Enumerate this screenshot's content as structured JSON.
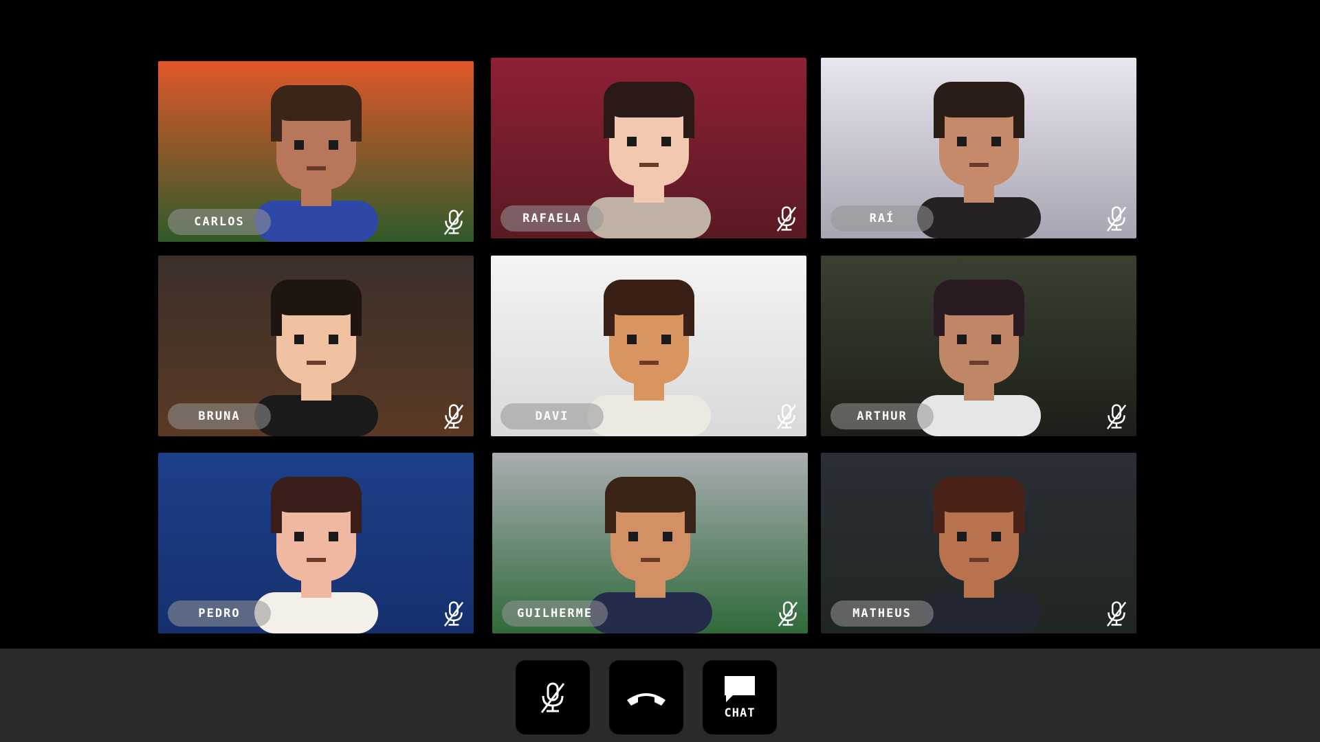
{
  "participants": [
    {
      "name": "CARLOS",
      "muted": true,
      "bg_top": "#e0572a",
      "bg_bottom": "#2f5a2a",
      "skin": "#b8765a",
      "hair": "#3b2418",
      "shirt": "#2f48a8"
    },
    {
      "name": "RAFAELA",
      "muted": true,
      "bg_top": "#8e2035",
      "bg_bottom": "#5a1a22",
      "skin": "#f2c8b0",
      "hair": "#2a1a16",
      "shirt": "#bfb2a4"
    },
    {
      "name": "RAÍ",
      "muted": true,
      "bg_top": "#e9e6ef",
      "bg_bottom": "#a9a4b2",
      "skin": "#c58a6a",
      "hair": "#2a1c16",
      "shirt": "#262224"
    },
    {
      "name": "BRUNA",
      "muted": true,
      "bg_top": "#3b2f2a",
      "bg_bottom": "#5a3a24",
      "skin": "#f0c2a2",
      "hair": "#1e1410",
      "shirt": "#1a1a1a"
    },
    {
      "name": "DAVI",
      "muted": true,
      "bg_top": "#f4f4f4",
      "bg_bottom": "#d9d9d9",
      "skin": "#d8955f",
      "hair": "#3a2014",
      "shirt": "#ece8e2"
    },
    {
      "name": "ARTHUR",
      "muted": true,
      "bg_top": "#3a4030",
      "bg_bottom": "#1c1f18",
      "skin": "#c08668",
      "hair": "#2a1a22",
      "shirt": "#e6e6e6"
    },
    {
      "name": "PEDRO",
      "muted": true,
      "bg_top": "#1d3f8a",
      "bg_bottom": "#16306e",
      "skin": "#f0b8a0",
      "hair": "#3a1e1a",
      "shirt": "#f4efe8"
    },
    {
      "name": "GUILHERME",
      "muted": true,
      "bg_top": "#a9adb2",
      "bg_bottom": "#2f6a3a",
      "skin": "#d29064",
      "hair": "#3a2418",
      "shirt": "#232c4a"
    },
    {
      "name": "MATHEUS",
      "muted": true,
      "bg_top": "#2a2e36",
      "bg_bottom": "#202622",
      "skin": "#b8724e",
      "hair": "#4a2218",
      "shirt": "#222630"
    }
  ],
  "controls": {
    "mute_icon": "mic-off-icon",
    "hangup_icon": "phone-hangup-icon",
    "chat_label": "CHAT",
    "chat_icon": "chat-bubble-icon"
  },
  "colors": {
    "page_bg": "#000000",
    "control_bar_bg": "#2a2a2a",
    "button_bg": "#000000",
    "name_pill_bg": "rgba(150,150,150,0.55)"
  }
}
